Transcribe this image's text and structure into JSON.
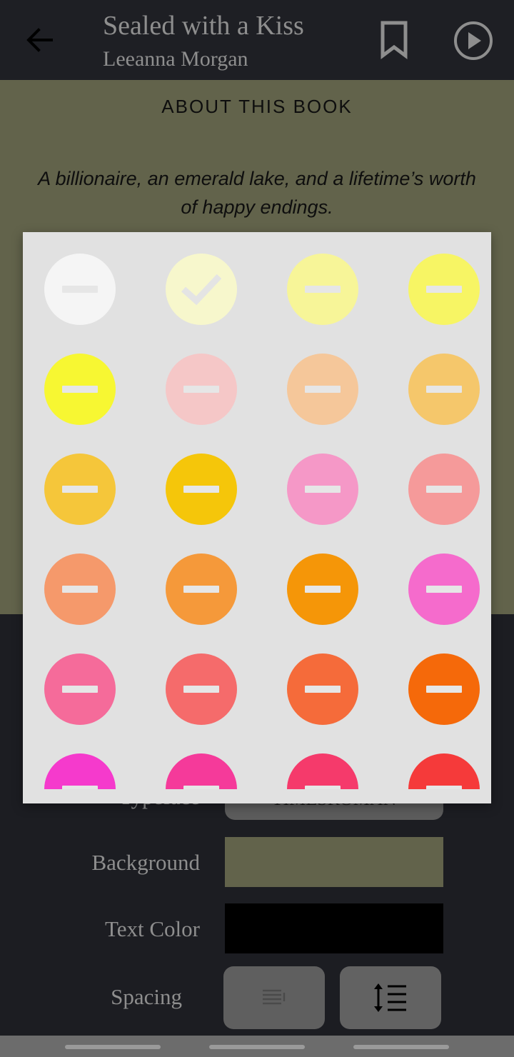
{
  "header": {
    "title": "Sealed with a Kiss",
    "author": "Leeanna Morgan"
  },
  "reading": {
    "heading": "ABOUT THIS BOOK",
    "blurb": "A billionaire, an emerald lake, and a lifetime’s worth of happy endings."
  },
  "settings": {
    "typeface_label": "Typeface",
    "typeface_value": "TIMESROMAN",
    "background_label": "Background",
    "background_color": "#62634b",
    "text_color_label": "Text Color",
    "text_color": "#000000",
    "spacing_label": "Spacing"
  },
  "color_picker": {
    "selected_index": 1,
    "colors": [
      "#f5f5f5",
      "#f7f7cc",
      "#f7f598",
      "#f7f564",
      "#f7f732",
      "#f5c7c7",
      "#f5c79a",
      "#f5c76b",
      "#f5c63a",
      "#f5c60a",
      "#f598c7",
      "#f59a9a",
      "#f5996b",
      "#f5993a",
      "#f59608",
      "#f56bcc",
      "#f56b9a",
      "#f56b6b",
      "#f56b3a",
      "#f5690a",
      "#f53acc",
      "#f53a9a",
      "#f53a6b",
      "#f53a3a"
    ]
  }
}
